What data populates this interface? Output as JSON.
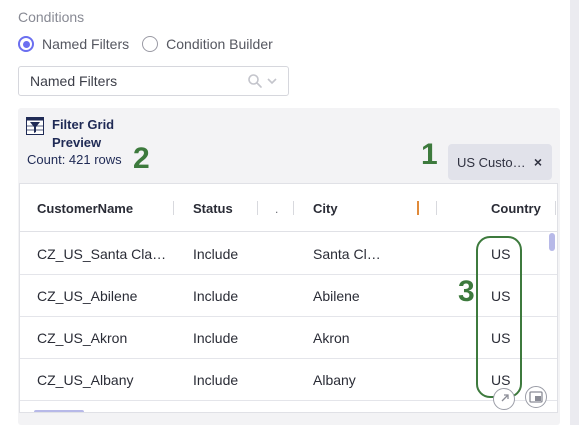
{
  "conditions": {
    "label": "Conditions",
    "options": [
      {
        "label": "Named Filters",
        "selected": true
      },
      {
        "label": "Condition Builder",
        "selected": false
      }
    ],
    "dropdown_value": "Named Filters"
  },
  "preview": {
    "title_line1": "Filter Grid",
    "title_line2": "Preview",
    "count": "Count: 421 rows",
    "chip_label": "US Custo…",
    "chip_close": "×",
    "markers": [
      "1",
      "2",
      "3"
    ]
  },
  "grid": {
    "columns": [
      "CustomerName",
      "Status",
      ".",
      "City",
      "Country"
    ],
    "rows": [
      {
        "name": "CZ_US_Santa Cla…",
        "status": "Include",
        "city": "Santa Cl…",
        "country": "US"
      },
      {
        "name": "CZ_US_Abilene",
        "status": "Include",
        "city": "Abilene",
        "country": "US"
      },
      {
        "name": "CZ_US_Akron",
        "status": "Include",
        "city": "Akron",
        "country": "US"
      },
      {
        "name": "CZ_US_Albany",
        "status": "Include",
        "city": "Albany",
        "country": "US"
      }
    ]
  },
  "colors": {
    "accent": "#6b6ff0",
    "marker": "#3d7a3d",
    "title": "#1f2a55"
  },
  "icons": [
    "search-icon",
    "chevron-down-icon",
    "filter-grid-icon",
    "close-icon",
    "expand-icon",
    "picture-in-picture-icon"
  ]
}
